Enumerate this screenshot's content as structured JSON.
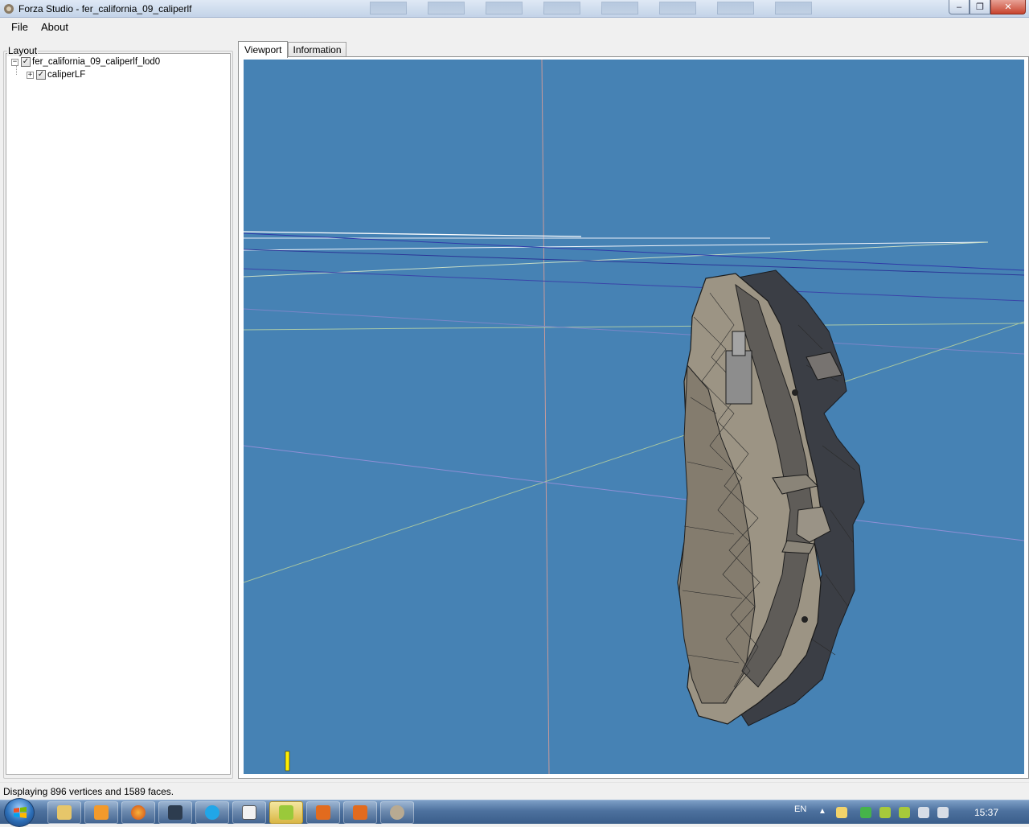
{
  "window": {
    "title": "Forza Studio - fer_california_09_caliperlf",
    "controls": {
      "minimize": "–",
      "maximize": "❐",
      "close": "✕"
    }
  },
  "menu": {
    "items": [
      "File",
      "About"
    ]
  },
  "layout": {
    "label": "Layout",
    "tree": {
      "root": {
        "label": "fer_california_09_caliperlf_lod0",
        "expander": "−",
        "checked": "✓"
      },
      "child": {
        "label": "caliperLF",
        "expander": "+",
        "checked": "✓"
      }
    }
  },
  "tabs": [
    "Viewport",
    "Information"
  ],
  "viewport": {
    "background": "#4682b4",
    "mesh_fill": "#8c8578",
    "mesh_dark": "#3b3e45",
    "axis_marker": "#ffee00"
  },
  "status": {
    "text": "Displaying 896 vertices and 1589 faces."
  },
  "taskbar": {
    "apps": [
      "explorer-icon",
      "media-player-icon",
      "firefox-icon",
      "terminal-icon",
      "notepad-icon",
      "forza-studio-icon",
      "z-app-icon",
      "z-app-icon-2",
      "forza-tool-icon"
    ],
    "tray": {
      "language": "EN",
      "clock": "15:37"
    }
  }
}
